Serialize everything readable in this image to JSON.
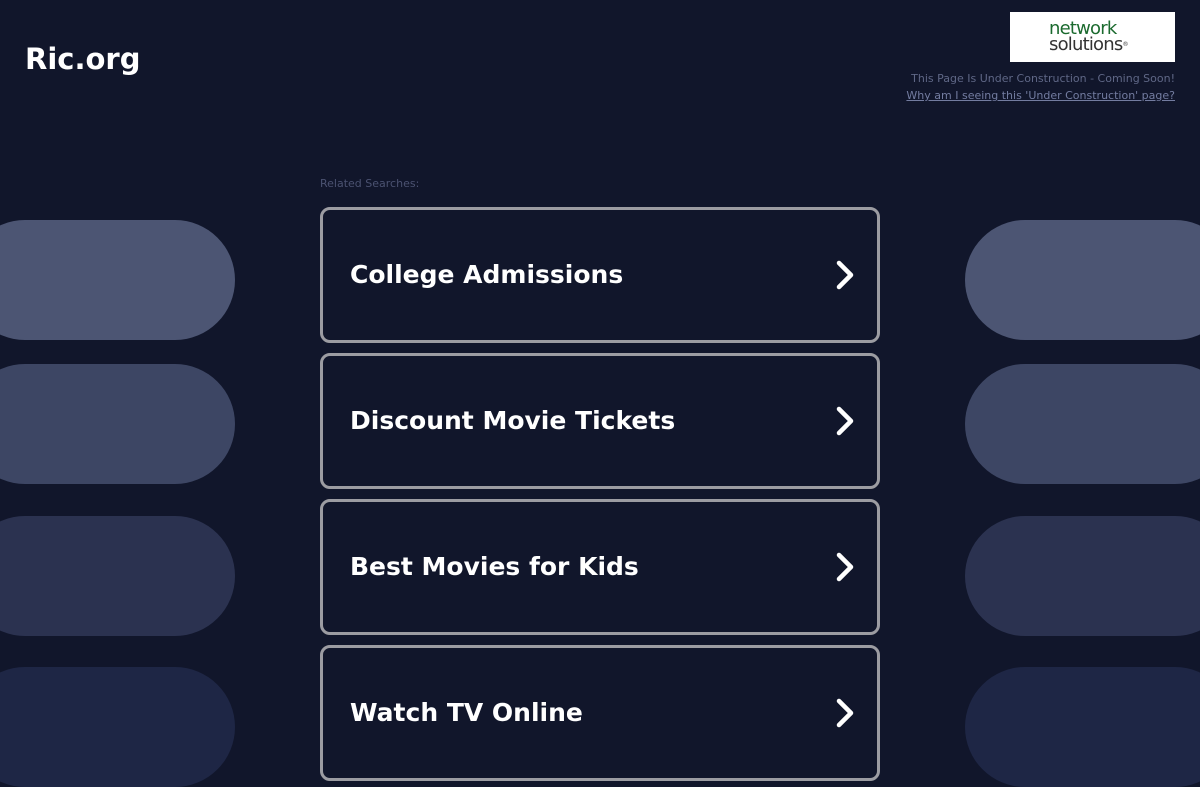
{
  "header": {
    "site_title": "Ric.org"
  },
  "logo": {
    "line1": "network",
    "line2": "solutions",
    "registered_mark": "®"
  },
  "notice": {
    "status_text": "This Page Is Under Construction - Coming Soon!",
    "why_link": "Why am I seeing this 'Under Construction' page?"
  },
  "related": {
    "label": "Related Searches:",
    "items": [
      {
        "label": "College Admissions",
        "icon": "chevron-right-icon"
      },
      {
        "label": "Discount Movie Tickets",
        "icon": "chevron-right-icon"
      },
      {
        "label": "Best Movies for Kids",
        "icon": "chevron-right-icon"
      },
      {
        "label": "Watch TV Online",
        "icon": "chevron-right-icon"
      }
    ]
  },
  "colors": {
    "background": "#11162b",
    "tile_border": "#9c9ca2",
    "text": "#ffffff",
    "logo_green": "#1b6a2e"
  }
}
